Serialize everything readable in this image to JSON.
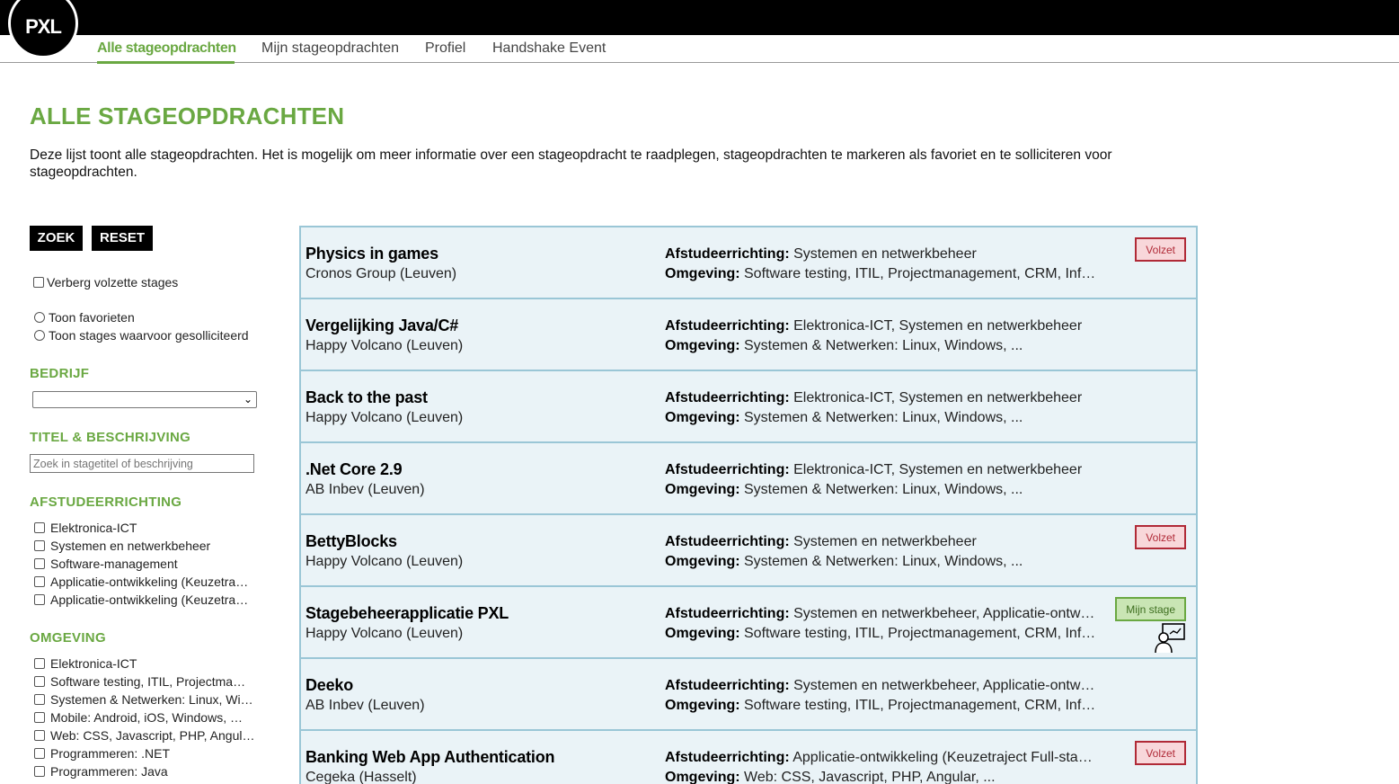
{
  "logo": {
    "text": "PXL"
  },
  "nav": {
    "items": [
      {
        "label": "Alle stageopdrachten",
        "active": true
      },
      {
        "label": "Mijn stageopdrachten",
        "active": false
      },
      {
        "label": "Profiel",
        "active": false
      },
      {
        "label": "Handshake Event",
        "active": false
      }
    ]
  },
  "page": {
    "title": "ALLE STAGEOPDRACHTEN",
    "intro": "Deze lijst toont alle stageopdrachten. Het is mogelijk om meer informatie over een stageopdracht te raadplegen, stageopdrachten te markeren als favoriet en te solliciteren voor stageopdrachten."
  },
  "filters": {
    "search_button": "ZOEK",
    "reset_button": "RESET",
    "hide_full_label": "Verberg volzette stages",
    "show_favorites_label": "Toon favorieten",
    "show_applied_label": "Toon stages waarvoor gesolliciteerd",
    "company": {
      "title": "BEDRIJF",
      "selected": ""
    },
    "title_desc": {
      "title": "TITEL & BESCHRIJVING",
      "placeholder": "Zoek in stagetitel of beschrijving"
    },
    "graduation": {
      "title": "AFSTUDEERRICHTING",
      "options": [
        "Elektronica-ICT",
        "Systemen en netwerkbeheer",
        "Software-management",
        "Applicatie-ontwikkeling (Keuzetra…",
        "Applicatie-ontwikkeling (Keuzetra…"
      ]
    },
    "environment": {
      "title": "OMGEVING",
      "options": [
        "Elektronica-ICT",
        "Software testing, ITIL, Projectma…",
        "Systemen & Netwerken: Linux, Wi…",
        "Mobile: Android, iOS, Windows, …",
        "Web: CSS, Javascript, PHP, Angul…",
        "Programmeren: .NET",
        "Programmeren: Java"
      ]
    }
  },
  "labels": {
    "afstudeerrichting": "Afstudeerrichting:",
    "omgeving": "Omgeving:"
  },
  "assignments": [
    {
      "title": "Physics in games",
      "company": "Cronos Group (Leuven)",
      "afstudeerrichting": "Systemen en netwerkbeheer",
      "omgeving": "Software testing, ITIL, Projectmanagement, CRM, Infor…",
      "badge": "Volzet",
      "badge_type": "full"
    },
    {
      "title": "Vergelijking Java/C#",
      "company": "Happy Volcano (Leuven)",
      "afstudeerrichting": "Elektronica-ICT, Systemen en netwerkbeheer",
      "omgeving": "Systemen & Netwerken: Linux, Windows, ...",
      "badge": "",
      "badge_type": ""
    },
    {
      "title": "Back to the past",
      "company": "Happy Volcano (Leuven)",
      "afstudeerrichting": "Elektronica-ICT, Systemen en netwerkbeheer",
      "omgeving": "Systemen & Netwerken: Linux, Windows, ...",
      "badge": "",
      "badge_type": ""
    },
    {
      "title": ".Net Core 2.9",
      "company": "AB Inbev (Leuven)",
      "afstudeerrichting": "Elektronica-ICT, Systemen en netwerkbeheer",
      "omgeving": "Systemen & Netwerken: Linux, Windows, ...",
      "badge": "",
      "badge_type": ""
    },
    {
      "title": "BettyBlocks",
      "company": "Happy Volcano (Leuven)",
      "afstudeerrichting": "Systemen en netwerkbeheer",
      "omgeving": "Systemen & Netwerken: Linux, Windows, ...",
      "badge": "Volzet",
      "badge_type": "full"
    },
    {
      "title": "Stagebeheerapplicatie PXL",
      "company": "Happy Volcano (Leuven)",
      "afstudeerrichting": "Systemen en netwerkbeheer, Applicatie-ontwik…",
      "omgeving": "Software testing, ITIL, Projectmanagement, CRM, Infor…",
      "badge": "Mijn stage",
      "badge_type": "mine",
      "icon": "presenter-icon"
    },
    {
      "title": "Deeko",
      "company": "AB Inbev (Leuven)",
      "afstudeerrichting": "Systemen en netwerkbeheer, Applicatie-ontwik…",
      "omgeving": "Software testing, ITIL, Projectmanagement, CRM, Infor…",
      "badge": "",
      "badge_type": ""
    },
    {
      "title": "Banking Web App Authentication",
      "company": "Cegeka (Hasselt)",
      "afstudeerrichting": "Applicatie-ontwikkeling (Keuzetraject Full-stack…",
      "omgeving": "Web: CSS, Javascript, PHP, Angular, ...",
      "badge": "Volzet",
      "badge_type": "full"
    }
  ]
}
